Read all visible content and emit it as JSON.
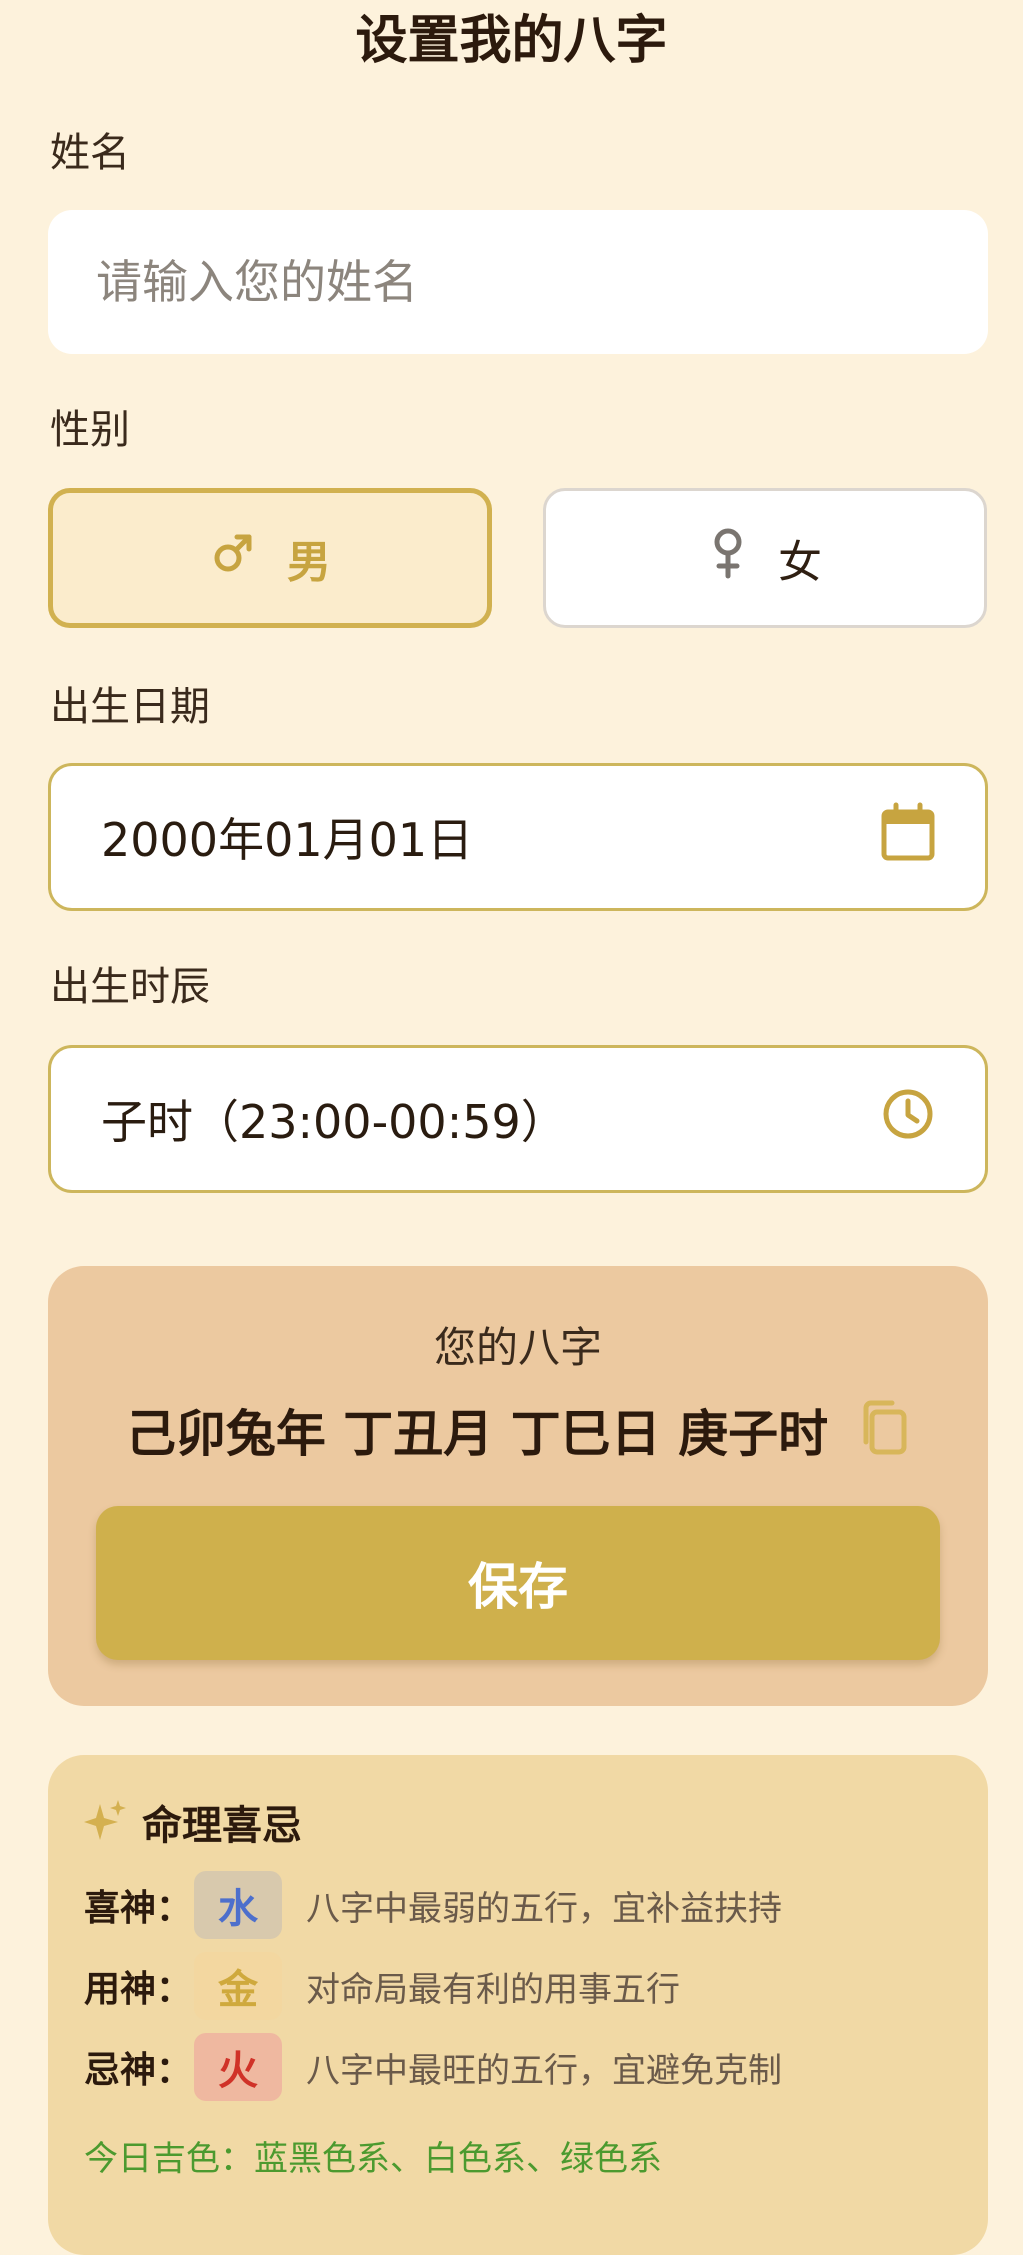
{
  "page": {
    "title": "设置我的八字"
  },
  "form": {
    "name_label": "姓名",
    "name_placeholder": "请输入您的姓名",
    "gender_label": "性别",
    "gender_male": "男",
    "gender_female": "女",
    "selected_gender": "男",
    "birth_date_label": "出生日期",
    "birth_date_value": "2000年01月01日",
    "birth_time_label": "出生时辰",
    "birth_time_value": "子时（23:00-00:59）"
  },
  "bazi": {
    "title": "您的八字",
    "value": "己卯兔年 丁丑月 丁巳日 庚子时",
    "save_label": "保存"
  },
  "fortune": {
    "title": "命理喜忌",
    "rows": [
      {
        "label": "喜神：",
        "element": "水",
        "desc": "八字中最弱的五行，宜补益扶持"
      },
      {
        "label": "用神：",
        "element": "金",
        "desc": "对命局最有利的用事五行"
      },
      {
        "label": "忌神：",
        "element": "火",
        "desc": "八字中最旺的五行，宜避免克制"
      }
    ],
    "lucky_colors": "今日吉色：蓝黑色系、白色系、绿色系"
  },
  "colors": {
    "background": "#fdf2dc",
    "accent": "#cfb04c",
    "bazi_card": "#ecc9a0",
    "fortune_card": "#f1d9a5",
    "lucky_green": "#4c9a2f"
  },
  "icons": {
    "male": "male-icon",
    "female": "female-icon",
    "calendar": "calendar-icon",
    "clock": "clock-icon",
    "copy": "copy-icon",
    "sparkle": "sparkle-icon"
  }
}
